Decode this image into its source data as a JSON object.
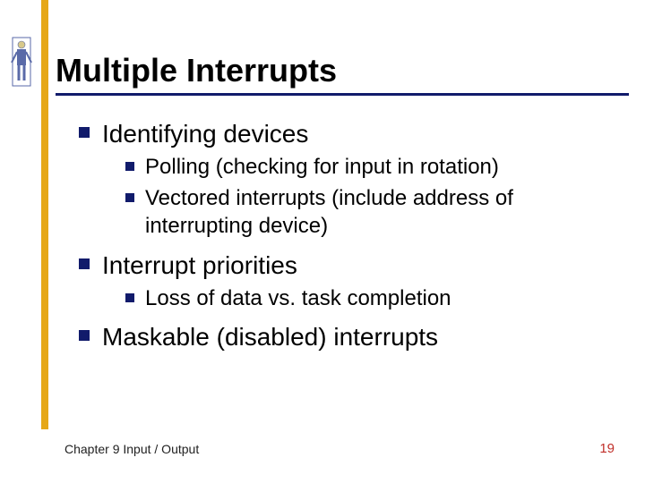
{
  "title": "Multiple Interrupts",
  "bullets": {
    "b1": "Identifying devices",
    "b1a": "Polling (checking for input in rotation)",
    "b1b": "Vectored interrupts  (include address of interrupting device)",
    "b2": "Interrupt priorities",
    "b2a": "Loss of data vs. task completion",
    "b3": "Maskable (disabled) interrupts"
  },
  "footer": {
    "left": "Chapter 9 Input / Output",
    "page": "19"
  }
}
